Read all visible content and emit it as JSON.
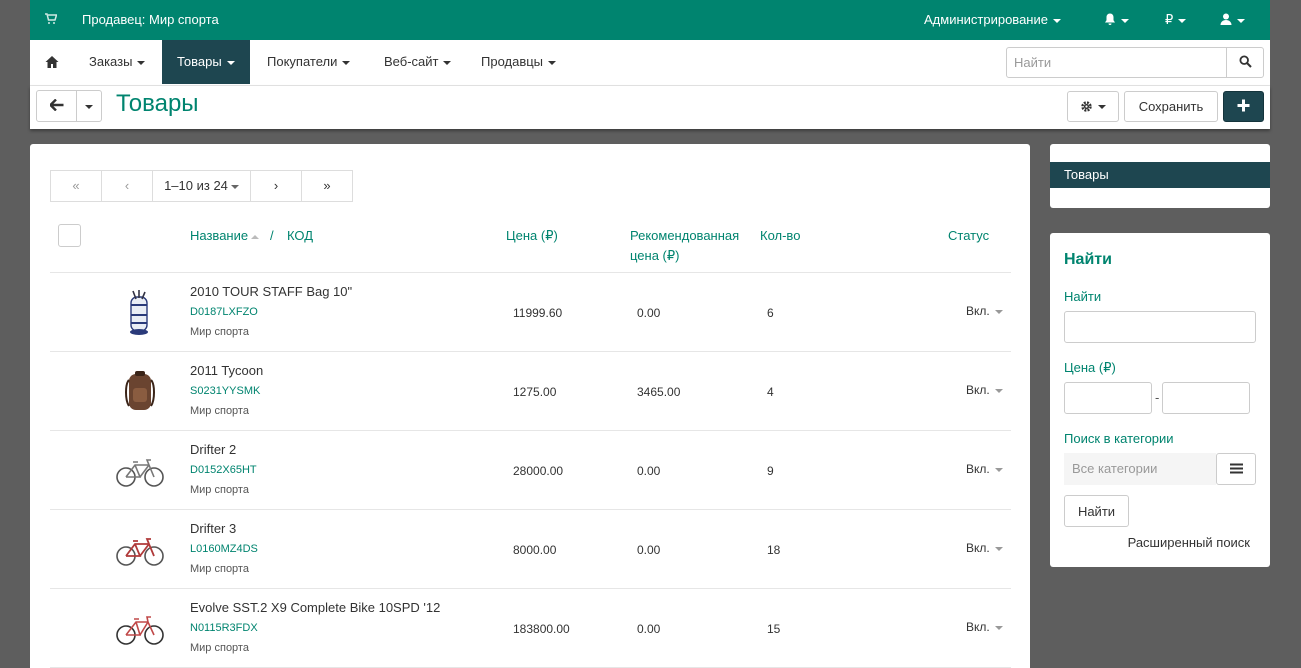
{
  "topbar": {
    "vendor": "Продавец: Мир спорта",
    "admin": "Администрирование",
    "currency_symbol": "₽",
    "brand_color": "#00846f"
  },
  "nav": {
    "items": [
      {
        "label": "Заказы"
      },
      {
        "label": "Товары",
        "active": true
      },
      {
        "label": "Покупатели"
      },
      {
        "label": "Веб-сайт"
      },
      {
        "label": "Продавцы"
      }
    ],
    "search_placeholder": "Найти"
  },
  "toolbar": {
    "title": "Товары",
    "save_label": "Сохранить"
  },
  "pager": {
    "first": "«",
    "prev": "‹",
    "range": "1–10 из 24",
    "next": "›",
    "last": "»"
  },
  "table": {
    "headers": {
      "name": "Название",
      "sep": "/",
      "code": "КОД",
      "price": "Цена (₽)",
      "list_price_line1": "Рекомендованная",
      "list_price_line2": "цена (₽)",
      "qty": "Кол-во",
      "status": "Статус"
    },
    "rows": [
      {
        "name": "2010 TOUR STAFF Bag 10\"",
        "code": "D0187LXFZO",
        "company": "Мир спорта",
        "price": "11999.60",
        "list_price": "0.00",
        "qty": "6",
        "status": "Вкл.",
        "thumb": "golf-bag-icon"
      },
      {
        "name": "2011 Tycoon",
        "code": "S0231YYSMK",
        "company": "Мир спорта",
        "price": "1275.00",
        "list_price": "3465.00",
        "qty": "4",
        "status": "Вкл.",
        "thumb": "backpack-icon"
      },
      {
        "name": "Drifter 2",
        "code": "D0152X65HT",
        "company": "Мир спорта",
        "price": "28000.00",
        "list_price": "0.00",
        "qty": "9",
        "status": "Вкл.",
        "thumb": "bicycle-icon"
      },
      {
        "name": "Drifter 3",
        "code": "L0160MZ4DS",
        "company": "Мир спорта",
        "price": "8000.00",
        "list_price": "0.00",
        "qty": "18",
        "status": "Вкл.",
        "thumb": "bicycle-icon"
      },
      {
        "name": "Evolve SST.2 X9 Complete Bike 10SPD '12",
        "code": "N0115R3FDX",
        "company": "Мир спорта",
        "price": "183800.00",
        "list_price": "0.00",
        "qty": "15",
        "status": "Вкл.",
        "thumb": "bicycle-icon"
      }
    ]
  },
  "sidebar": {
    "category": "Товары",
    "search": {
      "heading": "Найти",
      "find_label": "Найти",
      "price_label": "Цена (₽)",
      "range_sep": "-",
      "category_label": "Поиск в категории",
      "category_placeholder": "Все категории",
      "find_button": "Найти",
      "advanced": "Расширенный поиск"
    }
  }
}
